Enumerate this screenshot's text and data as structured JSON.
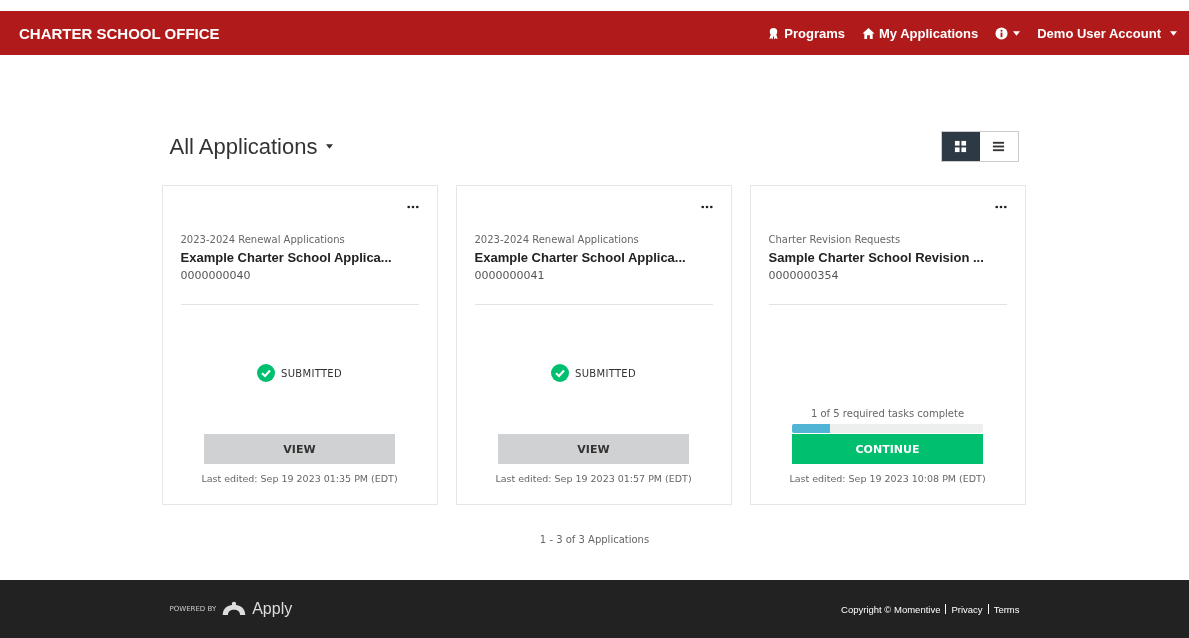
{
  "navbar": {
    "brand": "CHARTER SCHOOL OFFICE",
    "links": [
      {
        "label": "Programs"
      },
      {
        "label": "My Applications"
      }
    ],
    "account": "Demo User Account"
  },
  "heading": "All Applications",
  "view_toggle": [
    {
      "kind": "grid",
      "selected": true
    },
    {
      "kind": "list",
      "selected": false
    }
  ],
  "cards": [
    {
      "program": "2023-2024 Renewal Applications",
      "title": "Example Charter School Applica...",
      "number": "0000000040",
      "kind": "submitted",
      "status": "SUBMITTED",
      "button": "VIEW",
      "edited": "Last edited: Sep 19 2023 01:35 PM (EDT)"
    },
    {
      "program": "2023-2024 Renewal Applications",
      "title": "Example Charter School Applica...",
      "number": "0000000041",
      "kind": "submitted",
      "status": "SUBMITTED",
      "button": "VIEW",
      "edited": "Last edited: Sep 19 2023 01:57 PM (EDT)"
    },
    {
      "program": "Charter Revision Requests",
      "title": "Sample Charter School Revision ...",
      "number": "0000000354",
      "kind": "progress",
      "progress_text": "1 of 5 required tasks complete",
      "level": 0.2,
      "button": "CONTINUE",
      "edited": "Last edited: Sep 19 2023 10:08 PM (EDT)"
    }
  ],
  "pagination": "1 - 3 of 3 Applications",
  "footer": {
    "powered_by": "POWERED BY",
    "logo": "Apply",
    "copyright": "Copyright © Momentive",
    "links": [
      "Privacy",
      "Terms"
    ]
  }
}
